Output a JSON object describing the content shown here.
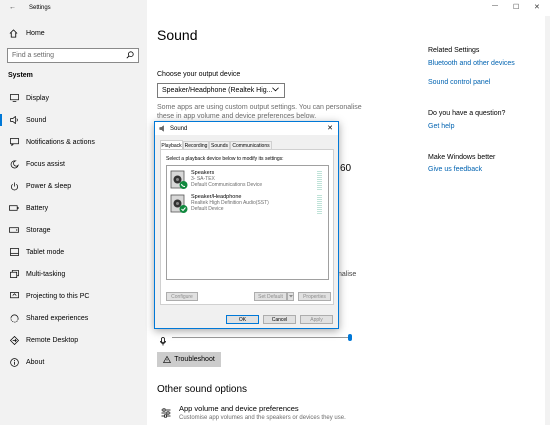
{
  "window": {
    "title": "Settings",
    "controls": {
      "minimize": "—",
      "maximize": "☐",
      "close": "✕"
    }
  },
  "sidebar": {
    "home_label": "Home",
    "search_placeholder": "Find a setting",
    "section_title": "System",
    "items": [
      {
        "label": "Display",
        "icon": "display-icon"
      },
      {
        "label": "Sound",
        "icon": "sound-icon",
        "active": true
      },
      {
        "label": "Notifications & actions",
        "icon": "notifications-icon"
      },
      {
        "label": "Focus assist",
        "icon": "focus-assist-icon"
      },
      {
        "label": "Power & sleep",
        "icon": "power-icon"
      },
      {
        "label": "Battery",
        "icon": "battery-icon"
      },
      {
        "label": "Storage",
        "icon": "storage-icon"
      },
      {
        "label": "Tablet mode",
        "icon": "tablet-icon"
      },
      {
        "label": "Multi-tasking",
        "icon": "multitasking-icon"
      },
      {
        "label": "Projecting to this PC",
        "icon": "projecting-icon"
      },
      {
        "label": "Shared experiences",
        "icon": "shared-icon"
      },
      {
        "label": "Remote Desktop",
        "icon": "remote-desktop-icon"
      },
      {
        "label": "About",
        "icon": "about-icon"
      }
    ]
  },
  "main": {
    "title": "Sound",
    "output_label": "Choose your output device",
    "output_value": "Speaker/Headphone (Realtek Hig...",
    "custom_note_line1": "Some apps are using custom output settings. You can personalise",
    "custom_note_line2": "these in app volume and device preferences below.",
    "partial_number": "60",
    "partial_word": "nalise",
    "troubleshoot_label": "Troubleshoot",
    "other_options_title": "Other sound options",
    "app_volume_title": "App volume and device preferences",
    "app_volume_desc": "Customise app volumes and the speakers or devices they use."
  },
  "related": {
    "title": "Related Settings",
    "links": [
      "Bluetooth and other devices",
      "Sound control panel"
    ],
    "question_title": "Do you have a question?",
    "help_link": "Get help",
    "better_title": "Make Windows better",
    "feedback_link": "Give us feedback"
  },
  "dialog": {
    "title": "Sound",
    "close": "✕",
    "tabs": [
      "Playback",
      "Recording",
      "Sounds",
      "Communications"
    ],
    "instruction": "Select a playback device below to modify its settings:",
    "devices": [
      {
        "name": "Speakers",
        "line2": "3- SA-TEX",
        "line3": "Default Communications Device"
      },
      {
        "name": "Speaker/Headphone",
        "line2": "Realtek High Definition Audio(SST)",
        "line3": "Default Device"
      }
    ],
    "buttons": {
      "configure": "Configure",
      "set_default": "Set Default",
      "properties": "Properties",
      "ok": "OK",
      "cancel": "Cancel",
      "apply": "Apply"
    }
  },
  "colors": {
    "accent": "#0078d7",
    "link": "#0063b1",
    "sidebar_bg": "#f2f2f2",
    "check_green": "#10893e"
  }
}
